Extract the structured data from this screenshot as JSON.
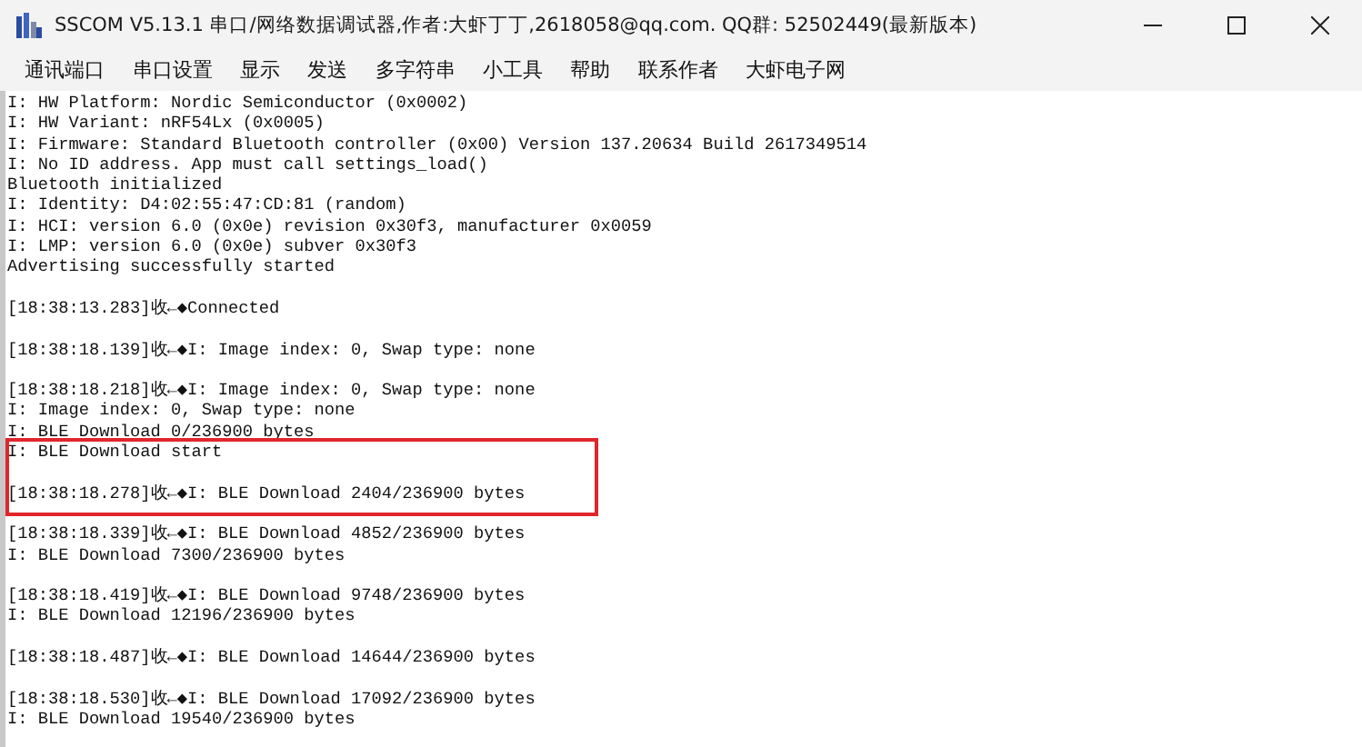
{
  "window": {
    "title": "SSCOM V5.13.1 串口/网络数据调试器,作者:大虾丁丁,2618058@qq.com. QQ群: 52502449(最新版本)"
  },
  "menu": [
    "通讯端口",
    "串口设置",
    "显示",
    "发送",
    "多字符串",
    "小工具",
    "帮助",
    "联系作者",
    "大虾电子网"
  ],
  "log": [
    {
      "kind": "text",
      "text": "I: HW Platform: Nordic Semiconductor (0x0002)",
      "highlighted": false
    },
    {
      "kind": "text",
      "text": "I: HW Variant: nRF54Lx (0x0005)",
      "highlighted": false
    },
    {
      "kind": "text",
      "text": "I: Firmware: Standard Bluetooth controller (0x00) Version 137.20634 Build 2617349514",
      "highlighted": false
    },
    {
      "kind": "text",
      "text": "I: No ID address. App must call settings_load()",
      "highlighted": false
    },
    {
      "kind": "text",
      "text": "Bluetooth initialized",
      "highlighted": false
    },
    {
      "kind": "text",
      "text": "I: Identity: D4:02:55:47:CD:81 (random)",
      "highlighted": false
    },
    {
      "kind": "text",
      "text": "I: HCI: version 6.0 (0x0e) revision 0x30f3, manufacturer 0x0059",
      "highlighted": false
    },
    {
      "kind": "text",
      "text": "I: LMP: version 6.0 (0x0e) subver 0x30f3",
      "highlighted": false
    },
    {
      "kind": "text",
      "text": "Advertising successfully started",
      "highlighted": false
    },
    {
      "kind": "blank",
      "highlighted": false
    },
    {
      "kind": "text",
      "text": "[18:38:13.283]收←◆Connected",
      "highlighted": false
    },
    {
      "kind": "blank",
      "highlighted": false
    },
    {
      "kind": "text",
      "text": "[18:38:18.139]收←◆I: Image index: 0, Swap type: none",
      "highlighted": false
    },
    {
      "kind": "blank",
      "highlighted": false
    },
    {
      "kind": "text",
      "text": "[18:38:18.218]收←◆I: Image index: 0, Swap type: none",
      "highlighted": false
    },
    {
      "kind": "text",
      "text": "I: Image index: 0, Swap type: none",
      "highlighted": false
    },
    {
      "kind": "text",
      "text": "I: BLE Download 0/236900 bytes",
      "highlighted": false
    },
    {
      "kind": "text",
      "text": "I: BLE Download start",
      "highlighted": true
    },
    {
      "kind": "blank",
      "highlighted": true
    },
    {
      "kind": "text",
      "text": "[18:38:18.278]收←◆I: BLE Download 2404/236900 bytes",
      "highlighted": true
    },
    {
      "kind": "blank",
      "highlighted": false
    },
    {
      "kind": "text",
      "text": "[18:38:18.339]收←◆I: BLE Download 4852/236900 bytes",
      "highlighted": false
    },
    {
      "kind": "text",
      "text": "I: BLE Download 7300/236900 bytes",
      "highlighted": false
    },
    {
      "kind": "blank",
      "highlighted": false
    },
    {
      "kind": "text",
      "text": "[18:38:18.419]收←◆I: BLE Download 9748/236900 bytes",
      "highlighted": false
    },
    {
      "kind": "text",
      "text": "I: BLE Download 12196/236900 bytes",
      "highlighted": false
    },
    {
      "kind": "blank",
      "highlighted": false
    },
    {
      "kind": "text",
      "text": "[18:38:18.487]收←◆I: BLE Download 14644/236900 bytes",
      "highlighted": false
    },
    {
      "kind": "blank",
      "highlighted": false
    },
    {
      "kind": "text",
      "text": "[18:38:18.530]收←◆I: BLE Download 17092/236900 bytes",
      "highlighted": false
    },
    {
      "kind": "text",
      "text": "I: BLE Download 19540/236900 bytes",
      "highlighted": false
    }
  ]
}
